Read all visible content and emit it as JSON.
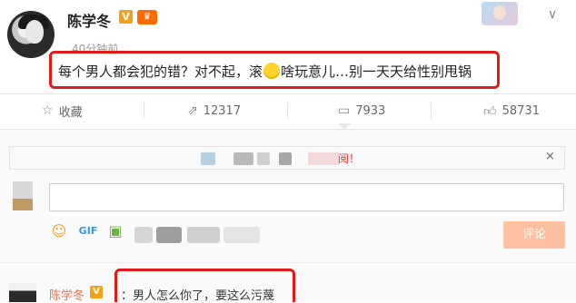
{
  "post": {
    "username": "陈学冬",
    "verified_badge": "V",
    "member_badge": "♛",
    "timestamp": "40分钟前",
    "text_before_emoji": "每个男人都会犯的错？对不起，滚",
    "emoji_icon": "smile-emoji",
    "text_after_emoji": "啥玩意儿…别一天天给性别甩锅"
  },
  "actions": {
    "favorite_label": "收藏",
    "repost_count": "12317",
    "comment_count": "7933",
    "like_count": "58731"
  },
  "comment_area": {
    "notice_visible_text": "阅！",
    "notice_close": "×",
    "input_placeholder": "",
    "submit_label": "评论"
  },
  "reply": {
    "username": "陈学冬",
    "verified_badge": "V",
    "text": "：男人怎么你了，要这么污蔑"
  },
  "colors": {
    "highlight_red": "#e11a1a",
    "brand_orange": "#eb7350",
    "submit_bg": "#ffc09f"
  }
}
